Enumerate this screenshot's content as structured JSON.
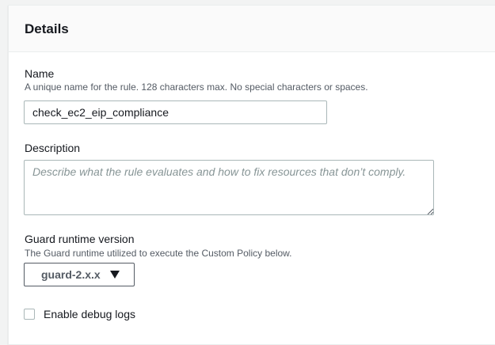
{
  "panel": {
    "title": "Details"
  },
  "name_field": {
    "label": "Name",
    "hint": "A unique name for the rule. 128 characters max. No special characters or spaces.",
    "value": "check_ec2_eip_compliance"
  },
  "description_field": {
    "label": "Description",
    "placeholder": "Describe what the rule evaluates and how to fix resources that don’t comply.",
    "value": ""
  },
  "guard_runtime": {
    "label": "Guard runtime version",
    "hint": "The Guard runtime utilized to execute the Custom Policy below.",
    "selected": "guard-2.x.x",
    "icon": "caret-down-icon"
  },
  "debug_logs": {
    "label": "Enable debug logs",
    "checked": false
  },
  "colors": {
    "text": "#16191f",
    "hint": "#545b64",
    "border": "#aab7b8",
    "placeholder": "#879596",
    "background": "#f2f3f3"
  }
}
